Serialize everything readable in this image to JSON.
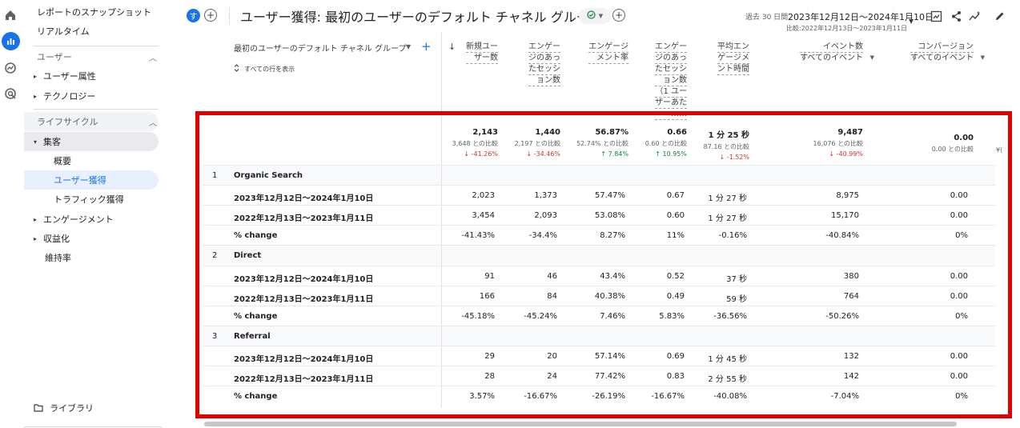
{
  "sidebar": {
    "snapshot": "レポートのスナップショット",
    "realtime": "リアルタイム",
    "user_section": "ユーザー",
    "user_attr": "ユーザー属性",
    "technology": "テクノロジー",
    "lifecycle_section": "ライフサイクル",
    "acquisition": "集客",
    "overview": "概要",
    "user_acquisition": "ユーザー獲得",
    "traffic_acquisition": "トラフィック獲得",
    "engagement": "エンゲージメント",
    "monetization": "収益化",
    "retention": "維持率",
    "library": "ライブラリ"
  },
  "header": {
    "avatar": "す",
    "title": "ユーザー獲得: 最初のユーザーのデフォルト チャネル グループ",
    "date_label": "過去 30 日間",
    "date_range": "2023年12月12日～2024年1月10日",
    "date_compare": "比較:2022年12月13日～2023年1月11日"
  },
  "table": {
    "dimension_header": "最初のユーザーのデフォルト チャネル グループ",
    "show_all_rows": "すべての行を表示",
    "columns": [
      [
        "新規ユー",
        "ザー数"
      ],
      [
        "エンゲー",
        "ジのあっ",
        "たセッシ",
        "ョン数"
      ],
      [
        "エンゲージ",
        "メント率"
      ],
      [
        "エンゲー",
        "ジのあっ",
        "たセッシ",
        "ョン数",
        "（1 ユー",
        "ザーあた",
        "……"
      ],
      [
        "平均エン",
        "ゲージメ",
        "ント時間"
      ],
      [
        "イベント数"
      ],
      [
        "コンバージョン"
      ]
    ],
    "event_sub": "すべてのイベント",
    "conversion_sub": "すべてのイベント",
    "clipped_text": "¥(",
    "totals": [
      {
        "value": "2,143",
        "compare": "3,648 との比較",
        "delta": "↓ -41.26%",
        "dir": "neg"
      },
      {
        "value": "1,440",
        "compare": "2,197 との比較",
        "delta": "↓ -34.46%",
        "dir": "neg"
      },
      {
        "value": "56.87%",
        "compare": "52.74% との比較",
        "delta": "↑ 7.84%",
        "dir": "pos"
      },
      {
        "value": "0.66",
        "compare": "0.60 との比較",
        "delta": "↑ 10.95%",
        "dir": "pos"
      },
      {
        "value": "1 分 25 秒",
        "compare": "87.16 との比較",
        "delta": "↓ -1.52%",
        "dir": "neg"
      },
      {
        "value": "9,487",
        "compare": "16,076 との比較",
        "delta": "↓ -40.99%",
        "dir": "neg"
      },
      {
        "value": "0.00",
        "compare": "0.00 との比較",
        "delta": "",
        "dir": "none"
      }
    ],
    "rows": [
      {
        "type": "group",
        "num": "1",
        "dim": "Organic Search"
      },
      {
        "type": "data",
        "dim": "2023年12月12日～2024年1月10日",
        "cells": [
          "2,023",
          "1,373",
          "57.47%",
          "0.67",
          "1 分 27 秒",
          "8,975",
          "0.00"
        ]
      },
      {
        "type": "data",
        "dim": "2022年12月13日～2023年1月11日",
        "cells": [
          "3,454",
          "2,093",
          "53.08%",
          "0.60",
          "1 分 27 秒",
          "15,170",
          "0.00"
        ]
      },
      {
        "type": "data",
        "dim": "% change",
        "cells": [
          "-41.43%",
          "-34.4%",
          "8.27%",
          "11%",
          "-0.16%",
          "-40.84%",
          "0%"
        ]
      },
      {
        "type": "group",
        "num": "2",
        "dim": "Direct"
      },
      {
        "type": "data",
        "dim": "2023年12月12日～2024年1月10日",
        "cells": [
          "91",
          "46",
          "43.4%",
          "0.52",
          "37 秒",
          "380",
          "0.00"
        ]
      },
      {
        "type": "data",
        "dim": "2022年12月13日～2023年1月11日",
        "cells": [
          "166",
          "84",
          "40.38%",
          "0.49",
          "59 秒",
          "764",
          "0.00"
        ]
      },
      {
        "type": "data",
        "dim": "% change",
        "cells": [
          "-45.18%",
          "-45.24%",
          "7.46%",
          "5.83%",
          "-36.56%",
          "-50.26%",
          "0%"
        ]
      },
      {
        "type": "group",
        "num": "3",
        "dim": "Referral"
      },
      {
        "type": "data",
        "dim": "2023年12月12日～2024年1月10日",
        "cells": [
          "29",
          "20",
          "57.14%",
          "0.69",
          "1 分 45 秒",
          "132",
          "0.00"
        ]
      },
      {
        "type": "data",
        "dim": "2022年12月13日～2023年1月11日",
        "cells": [
          "28",
          "24",
          "77.42%",
          "0.83",
          "2 分 55 秒",
          "142",
          "0.00"
        ]
      },
      {
        "type": "data",
        "dim": "% change",
        "cells": [
          "3.57%",
          "-16.67%",
          "-26.19%",
          "-16.67%",
          "-40.08%",
          "-7.04%",
          "0%"
        ]
      }
    ]
  },
  "colors": {
    "accent": "#1a73e8",
    "highlight_box": "#e00000",
    "negative": "#d93025",
    "positive": "#188038",
    "active_nav_bg": "#e8f0fe"
  }
}
